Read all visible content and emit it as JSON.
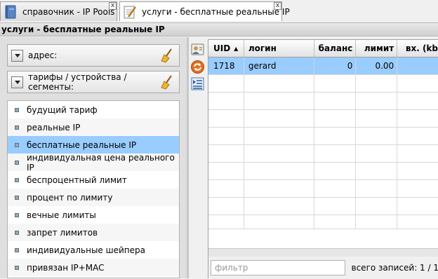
{
  "tabs": [
    {
      "label": "справочник - IP Pools",
      "close": "x"
    },
    {
      "label": "услуги - бесплатные реальные IP",
      "close": "x"
    }
  ],
  "page_title": "услуги - бесплатные реальные IP",
  "filters": {
    "address_label": "адрес:",
    "tariffs_label": "тарифы / устройства / сегменты:"
  },
  "services": [
    {
      "label": "будущий тариф"
    },
    {
      "label": "реальные IP"
    },
    {
      "label": "бесплатные реальные IP",
      "selected": true
    },
    {
      "label": "индивидуальная цена реального IP"
    },
    {
      "label": "беспроцентный лимит"
    },
    {
      "label": "процент по лимиту"
    },
    {
      "label": "вечные лимиты"
    },
    {
      "label": "запрет лимитов"
    },
    {
      "label": "индивидуальные шейпера"
    },
    {
      "label": "привязан IP+MAC"
    }
  ],
  "grid": {
    "columns": [
      "UID",
      "логин",
      "баланс",
      "лимит",
      "вх. (kb"
    ],
    "sort_indicator": "▲",
    "rows": [
      {
        "uid": "1718",
        "login": "gerard",
        "balance": "0",
        "limit": "0.00",
        "in": ""
      }
    ]
  },
  "footer": {
    "filter_placeholder": "фильтр",
    "record_count": "всего записей: 1 / 1"
  },
  "colors": {
    "selection": "#99ccff",
    "accent": "#e07020"
  },
  "icons": [
    "notebook-icon",
    "pencil-icon",
    "close-icon",
    "chevron-down-icon",
    "broom-icon",
    "user-card-icon",
    "refresh-icon",
    "list-icon",
    "bullet-icon"
  ]
}
